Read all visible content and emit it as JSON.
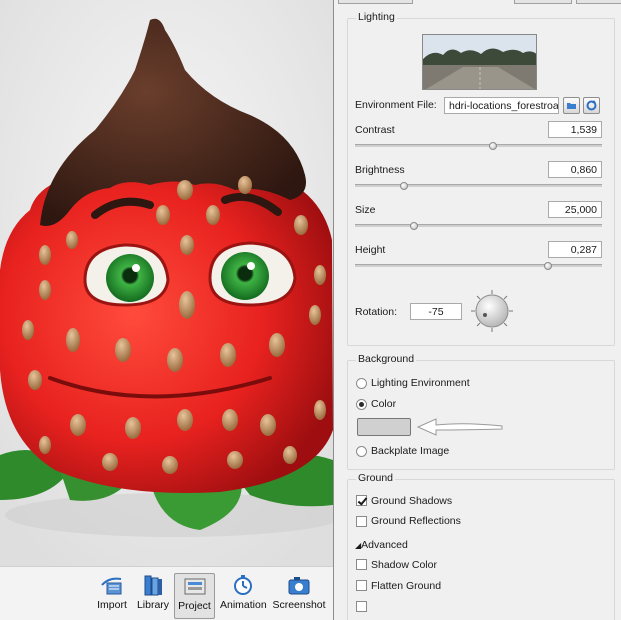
{
  "toolbar": {
    "items": [
      {
        "label": "Import",
        "icon": "import-icon",
        "active": false
      },
      {
        "label": "Library",
        "icon": "library-icon",
        "active": false
      },
      {
        "label": "Project",
        "icon": "project-icon",
        "active": true
      },
      {
        "label": "Animation",
        "icon": "animation-icon",
        "active": false
      },
      {
        "label": "Screenshot",
        "icon": "screenshot-icon",
        "active": false
      }
    ]
  },
  "lighting": {
    "title": "Lighting",
    "environment_label": "Environment File:",
    "environment_value": "hdri-locations_forestroad_",
    "sliders": [
      {
        "label": "Contrast",
        "value": "1,539",
        "fraction": 0.56
      },
      {
        "label": "Brightness",
        "value": "0,860",
        "fraction": 0.2
      },
      {
        "label": "Size",
        "value": "25,000",
        "fraction": 0.24
      },
      {
        "label": "Height",
        "value": "0,287",
        "fraction": 0.78
      }
    ],
    "rotation_label": "Rotation:",
    "rotation_value": "-75"
  },
  "background": {
    "title": "Background",
    "options": [
      {
        "label": "Lighting Environment",
        "selected": false
      },
      {
        "label": "Color",
        "selected": true
      },
      {
        "label": "Backplate Image",
        "selected": false
      }
    ],
    "color": "#d0d0d0"
  },
  "ground": {
    "title": "Ground",
    "checks": [
      {
        "label": "Ground Shadows",
        "checked": true
      },
      {
        "label": "Ground Reflections",
        "checked": false
      }
    ],
    "advanced_label": "Advanced",
    "advanced_checks": [
      {
        "label": "Shadow Color",
        "checked": false
      },
      {
        "label": "Flatten Ground",
        "checked": false
      }
    ]
  },
  "colors": {
    "panel_bg": "#f0f0f0",
    "strawberry_red": "#e8221f",
    "chocolate": "#4a2a1e",
    "eye_green": "#1e8a2a"
  }
}
